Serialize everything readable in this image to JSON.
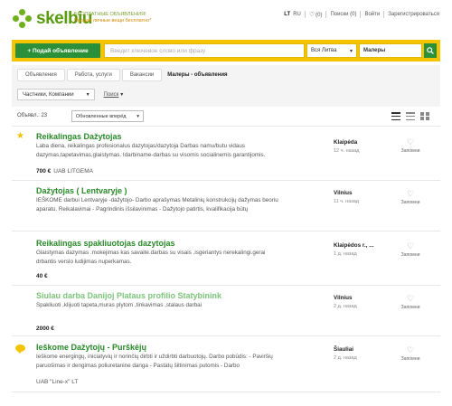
{
  "brand": {
    "name": "skelbiu",
    "tagline_1": "БЕСПЛАТНЫЕ ОБЪЯВЛЕНИЯ!",
    "tagline_2": "Продай личные вещи бесплатно*"
  },
  "topnav": {
    "lang_lt": "LT",
    "lang_ru": "RU",
    "favorites": "(0)",
    "searches": "Поиски (0)",
    "login": "Войти",
    "register": "Зарегистрироваться"
  },
  "search": {
    "add_button": "+ Подай объявление",
    "placeholder": "Введит ключевое слово или фразу",
    "region": "Вся Литва",
    "category": "Малеры"
  },
  "breadcrumbs": [
    "Объявления",
    "Работа, услуги",
    "Вакансии",
    "Малеры - объявления"
  ],
  "filters": {
    "seller_type": "Частники, Компании",
    "more": "Поиск"
  },
  "results": {
    "count_label": "Объявл.: 23",
    "sort": "Обновленные вперёд"
  },
  "colors": {
    "accent_yellow": "#f5c400",
    "brand_green": "#2c8f3a",
    "title_green": "#2a8a2a"
  },
  "listings": [
    {
      "title": "Reikalingas Dažytojas",
      "desc": "Laba diena, reikalingas profesionalus dazytojas/dazytoja Darbas namu/butu vidaus dazymas,tapetavimas,glaistymas. Idarbiname-darbas su visomis socialinemis garantijomis.",
      "price": "700 €",
      "seller": "UAB LITGEMA",
      "city": "Klaipėda",
      "time": "12 ч. назад",
      "fav": "Запомни",
      "badge": "star"
    },
    {
      "title": "Dažytojas ( Lentvaryje )",
      "desc": "IEŠKOME darbui Lentvaryje -dažytojo- Darbo aprašymas Metalinių konstrukcijų dažymas beoriu aparatu. Reikalavimai - Pagrindinis išsilavinimas - Dažytojo patirtis, kvalifikacija būtų",
      "price": "",
      "seller": "",
      "city": "Vilnius",
      "time": "11 ч. назад",
      "fav": "Запомни",
      "badge": ""
    },
    {
      "title": "Reikalingas spakliuotojas dazytojas",
      "desc": "Glaistymas dazymas .mokejimas kas savaite.darbas su visais .isgeriantys nerekalingi.gerai drbantis verslo ludijimas nuperkamas.",
      "price": "40 €",
      "seller": "",
      "city": "Klaipėdos r., ...",
      "time": "1 д. назад",
      "fav": "Запомни",
      "badge": ""
    },
    {
      "title": "Siulau darba Danijoj Plataus profilio Statybinink",
      "desc": "Spakliuoti ,klijuoti tapeta,muras plytom ,tinkavimas ,stalaus darbai",
      "price": "2000 €",
      "seller": "",
      "city": "Vilnius",
      "time": "2 д. назад",
      "fav": "Запомни",
      "badge": ""
    },
    {
      "title": "Ieškome Dažytojų - Purškėjų",
      "desc": "Ieškome energingų, iniciatyvių ir norinčių dirbti ir uždirbti darbuotojų. Darbo pobūdis: - Paviršių paruošimas ir dengimas poliuretanine danga - Pastatų šiltinimas putomis - Darbo",
      "price": "",
      "seller": "UAB \"Line-x\" LT",
      "city": "Šiauliai",
      "time": "2 д. назад",
      "fav": "Запомни",
      "badge": "chat"
    }
  ]
}
